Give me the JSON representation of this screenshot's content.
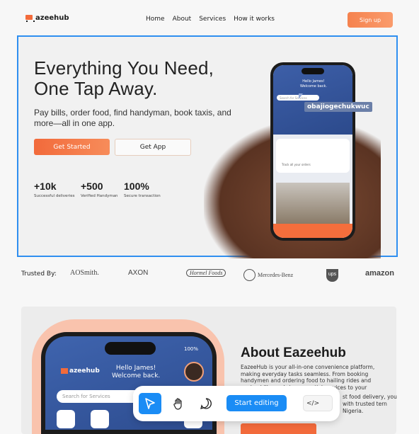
{
  "navbar": {
    "logo_text": "azeehub",
    "links": [
      "Home",
      "About",
      "Services",
      "How it works"
    ],
    "signup_label": "Sign up"
  },
  "hero": {
    "title_line1": "Everything You Need,",
    "title_line2": "One Tap Away.",
    "subtitle": "Pay bills, order food, find handyman, book taxis, and more—all in one app.",
    "primary_button": "Get Started",
    "secondary_button": "Get App",
    "stats": [
      {
        "value": "+10k",
        "label": "Successful deliveries"
      },
      {
        "value": "+500",
        "label": "Verified Handyman"
      },
      {
        "value": "100%",
        "label": "Secure transaction"
      }
    ],
    "phone": {
      "greeting": "Hello James!",
      "greeting_sub": "Welcome back.",
      "search_placeholder": "Search for Services",
      "track_text": "Track all your orders"
    },
    "cursor_tag": "obajiogechukwuc"
  },
  "trusted": {
    "label": "Trusted By:",
    "brands": [
      "AOSmith.",
      "AXON",
      "Hormel Foods",
      "Mercedes-Benz",
      "ups",
      "amazon"
    ]
  },
  "about": {
    "title": "About Eazeehub",
    "text1": "EazeeHub is your all-in-one convenience platform, making everyday tasks seamless. From booking handymen and ordering food to hailing rides and paying bills, we bring essential services to your fingertips.",
    "text2": "st food delivery, you with trusted tern Nigeria.",
    "phone": {
      "logo": "azeehub",
      "greeting": "Hello James!",
      "greeting_sub": "Welcome back.",
      "search_placeholder": "Search for Services",
      "battery": "100%"
    }
  },
  "toolbar": {
    "start_label": "Start editing",
    "code_label": "</>"
  }
}
